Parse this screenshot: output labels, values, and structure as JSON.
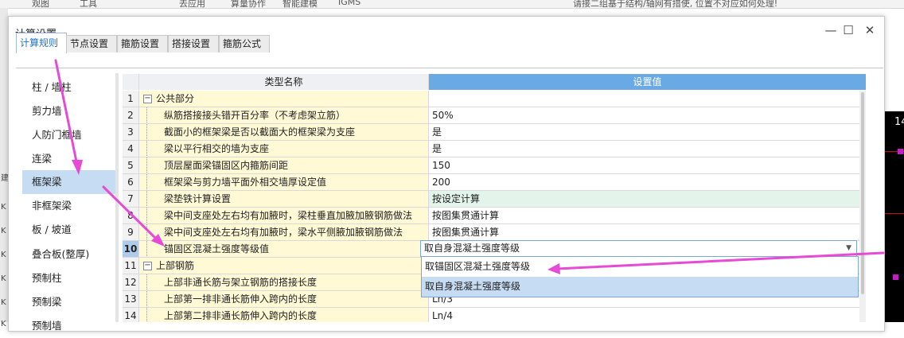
{
  "background": {
    "top_items": [
      "观图",
      "工具",
      "去应用",
      "算量协作",
      "智能建模",
      "IGMS"
    ],
    "right_text": "请接二组基于结构/轴网有措使, 位置不对应如何处理!",
    "right_number": "14",
    "left_chars": [
      "建",
      "K",
      "K",
      "K",
      "K",
      "K",
      "K"
    ]
  },
  "dialog": {
    "title": "计算设置",
    "minimize": "—",
    "maximize": "☐",
    "close": "✕"
  },
  "tabs": [
    "计算规则",
    "节点设置",
    "箍筋设置",
    "搭接设置",
    "箍筋公式"
  ],
  "sidebar": {
    "items": [
      "柱 / 墙柱",
      "剪力墙",
      "人防门框墙",
      "连梁",
      "框架梁",
      "非框架梁",
      "板 / 坡道",
      "叠合板(整厚)",
      "预制柱",
      "预制梁",
      "预制墙"
    ],
    "selected_index": 4
  },
  "grid": {
    "headers": {
      "name": "类型名称",
      "value": "设置值"
    },
    "rows": [
      {
        "num": "1",
        "name": "公共部分",
        "value": "",
        "group": true
      },
      {
        "num": "2",
        "name": "纵筋搭接接头错开百分率（不考虑架立筋）",
        "value": "50%"
      },
      {
        "num": "3",
        "name": "截面小的框架梁是否以截面大的框架梁为支座",
        "value": "是"
      },
      {
        "num": "4",
        "name": "梁以平行相交的墙为支座",
        "value": "是"
      },
      {
        "num": "5",
        "name": "顶层屋面梁锚固区内箍筋间距",
        "value": "150"
      },
      {
        "num": "6",
        "name": "框架梁与剪力墙平面外相交墙厚设定值",
        "value": "200"
      },
      {
        "num": "7",
        "name": "梁垫铁计算设置",
        "value": "按设定计算",
        "highlight": true
      },
      {
        "num": "8",
        "name": "梁中间支座处左右均有加腋时，梁柱垂直加腋加腋钢筋做法",
        "value": "按图集贯通计算"
      },
      {
        "num": "9",
        "name": "梁中间支座处左右均有加腋时，梁水平侧腋加腋钢筋做法",
        "value": "按图集贯通计算"
      },
      {
        "num": "10",
        "name": "锚固区混凝土强度等级值",
        "value": "",
        "active": true
      },
      {
        "num": "11",
        "name": "上部钢筋",
        "value": "",
        "group": true
      },
      {
        "num": "12",
        "name": "上部非通长筋与架立钢筋的搭接长度",
        "value": ""
      },
      {
        "num": "13",
        "name": "上部第一排非通长筋伸入跨内的长度",
        "value": "Ln/3"
      },
      {
        "num": "14",
        "name": "上部第二排非通长筋伸入跨内的长度",
        "value": "Ln/4"
      }
    ]
  },
  "combo": {
    "value": "取自身混凝土强度等级",
    "options": [
      "取锚固区混凝土强度等级",
      "取自身混凝土强度等级"
    ],
    "selected_index": 1
  },
  "colors": {
    "header_value_bg": "#6aaae4",
    "name_column_bg": "#fff9d6",
    "highlight_row_bg": "#e3f4ea",
    "selection_bg": "#c6dcf2",
    "annotation_arrow": "#e64ad6"
  }
}
